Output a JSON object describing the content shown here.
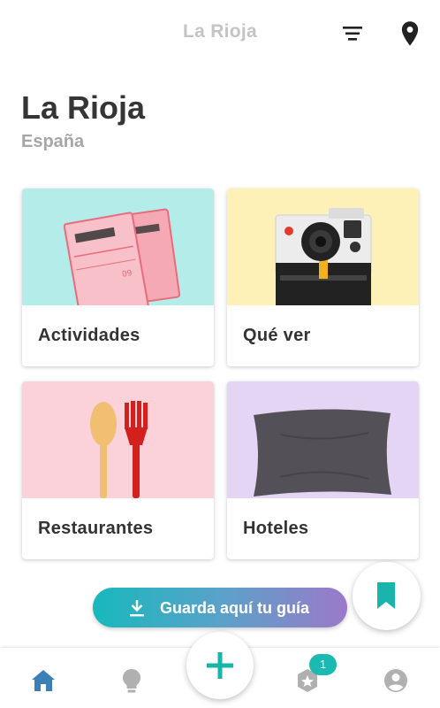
{
  "header": {
    "title": "La Rioja",
    "filter_icon": "filter-lines-icon",
    "location_icon": "location-pin-icon"
  },
  "page": {
    "title": "La Rioja",
    "subtitle": "España"
  },
  "categories": [
    {
      "label": "Actividades",
      "image": "tickets-image",
      "bg": "#b4ecea"
    },
    {
      "label": "Qué ver",
      "image": "camera-image",
      "bg": "#fdf1b7"
    },
    {
      "label": "Restaurantes",
      "image": "spoon-fork-image",
      "bg": "#fbd2da"
    },
    {
      "label": "Hoteles",
      "image": "pillow-image",
      "bg": "#e3d5f3"
    }
  ],
  "save_guide": {
    "label": "Guarda aquí tu guía",
    "icon": "download-icon"
  },
  "bookmark": {
    "icon": "bookmark-icon",
    "color": "#19b5ac"
  },
  "bottom_nav": {
    "items": [
      {
        "icon": "home-icon",
        "active": true
      },
      {
        "icon": "lightbulb-icon",
        "active": false
      },
      {
        "icon": "add-icon",
        "active": false
      },
      {
        "icon": "badge-star-icon",
        "active": false,
        "badge": "1"
      },
      {
        "icon": "profile-icon",
        "active": false
      }
    ]
  },
  "colors": {
    "accent": "#19b5ac",
    "nav_active": "#3c7fb6",
    "nav_inactive": "#b0b0b0"
  }
}
